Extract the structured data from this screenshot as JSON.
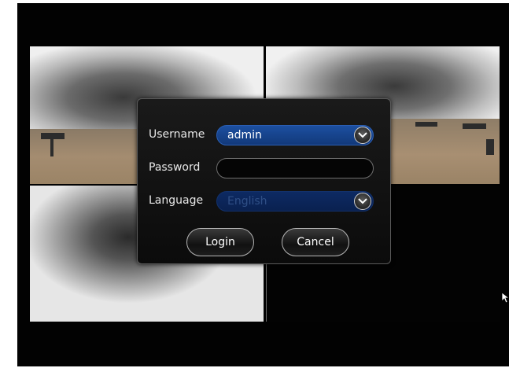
{
  "dialog": {
    "username_label": "Username",
    "username_value": "admin",
    "password_label": "Password",
    "password_value": "",
    "language_label": "Language",
    "language_value": "English",
    "login_label": "Login",
    "cancel_label": "Cancel"
  },
  "icons": {
    "dropdown": "chevron-down-icon",
    "cursor": "mouse-pointer-icon"
  },
  "colors": {
    "selected_field": "#1c4fa0",
    "language_field": "#0d2a63",
    "dialog_bg": "#111111"
  }
}
